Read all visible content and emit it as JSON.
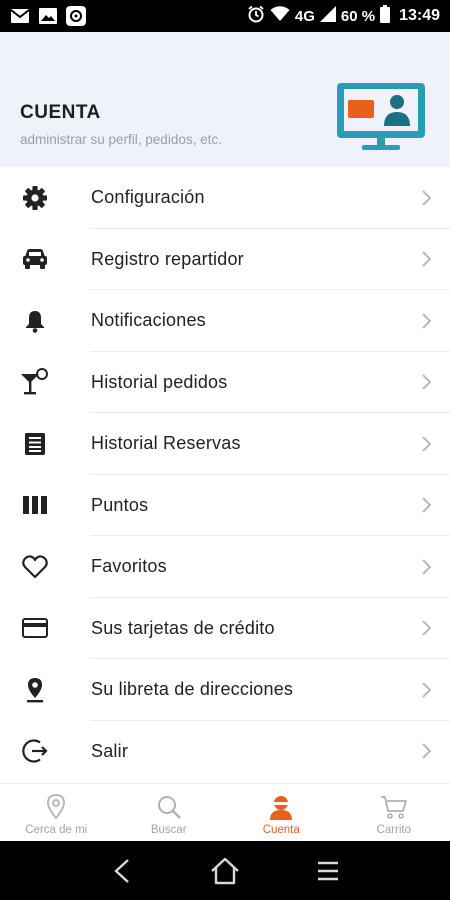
{
  "status_bar": {
    "network": "4G",
    "battery": "60 %",
    "time": "13:49"
  },
  "header": {
    "title": "CUENTA",
    "subtitle": "administrar su perfil, pedidos, etc."
  },
  "menu": {
    "items": [
      {
        "label": "Configuración",
        "icon": "gear-icon"
      },
      {
        "label": "Registro repartidor",
        "icon": "car-icon"
      },
      {
        "label": "Notificaciones",
        "icon": "bell-icon"
      },
      {
        "label": "Historial pedidos",
        "icon": "cocktail-icon"
      },
      {
        "label": "Historial Reservas",
        "icon": "list-icon"
      },
      {
        "label": "Puntos",
        "icon": "columns-icon"
      },
      {
        "label": "Favoritos",
        "icon": "heart-icon"
      },
      {
        "label": "Sus tarjetas de crédito",
        "icon": "credit-card-icon"
      },
      {
        "label": "Su libreta de direcciones",
        "icon": "map-pin-icon"
      },
      {
        "label": "Salir",
        "icon": "logout-icon"
      }
    ]
  },
  "bottom_nav": {
    "items": [
      {
        "label": "Cerca de mi",
        "icon": "location-icon",
        "active": false
      },
      {
        "label": "Buscar",
        "icon": "search-icon",
        "active": false
      },
      {
        "label": "Cuenta",
        "icon": "account-icon",
        "active": true
      },
      {
        "label": "Carrito",
        "icon": "cart-icon",
        "active": false
      }
    ]
  },
  "colors": {
    "accent": "#e8601c",
    "teal": "#2a9db5",
    "header_bg": "#eef2f9"
  }
}
